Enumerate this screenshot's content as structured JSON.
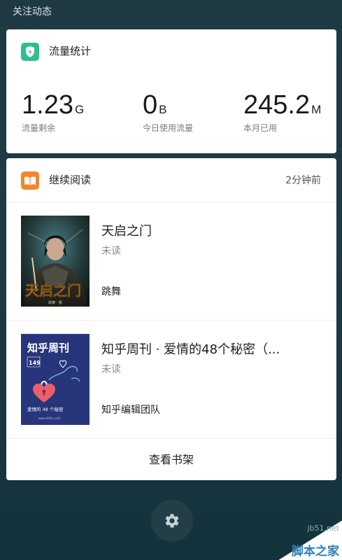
{
  "header": {
    "title": "关注动态"
  },
  "traffic_card": {
    "title": "流量统计",
    "icon": "shield-icon",
    "accent_color": "#2fbf8f",
    "stats": [
      {
        "value": "1.23",
        "unit": "G",
        "label": "流量剩余"
      },
      {
        "value": "0",
        "unit": "B",
        "label": "今日使用流量"
      },
      {
        "value": "245.2",
        "unit": "M",
        "label": "本月已用"
      }
    ]
  },
  "reading_card": {
    "title": "继续阅读",
    "time": "2分钟前",
    "icon": "book-icon",
    "accent_color": "#f0882a",
    "books": [
      {
        "title": "天启之门",
        "status": "未读",
        "author": "跳舞",
        "cover": {
          "title": "天启之门",
          "byline": "跳舞 · 著"
        }
      },
      {
        "title": "知乎周刊 · 爱情的48个秘密（...",
        "status": "未读",
        "author": "知乎编辑团队",
        "cover": {
          "title": "知乎周刊",
          "issue": "149",
          "caption": "爱情的 48 个秘密",
          "site": "www.zhihu.com",
          "bg_color": "#27367a"
        }
      }
    ],
    "bookshelf_label": "查看书架"
  },
  "settings": {
    "icon": "gear-icon"
  },
  "watermark": {
    "url": "jb51.net",
    "name": "脚本之家"
  }
}
